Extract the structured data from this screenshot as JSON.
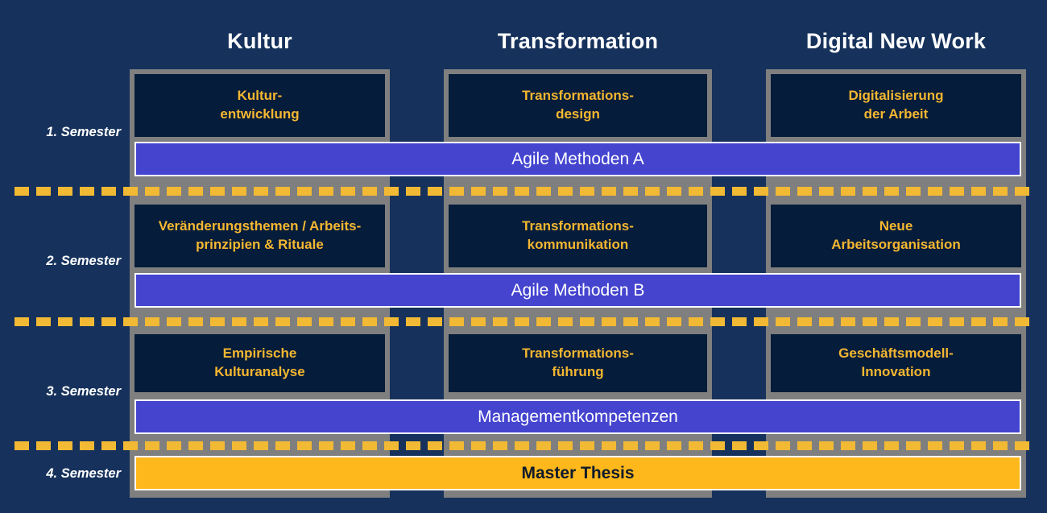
{
  "diagram": {
    "title_columns": [
      {
        "label": "Kultur"
      },
      {
        "label": "Transformation"
      },
      {
        "label": "Digital New Work"
      }
    ],
    "semesters": [
      {
        "label": "1. Semester"
      },
      {
        "label": "2. Semester"
      },
      {
        "label": "3. Semester"
      },
      {
        "label": "4. Semester"
      }
    ],
    "modules": {
      "s1": [
        {
          "text": "Kultur-\nentwicklung"
        },
        {
          "text": "Transformations-\ndesign"
        },
        {
          "text": "Digitalisierung\nder Arbeit"
        }
      ],
      "s2": [
        {
          "text": "Veränderungsthemen / Arbeits-\nprinzipien & Rituale"
        },
        {
          "text": "Transformations-\nkommunikation"
        },
        {
          "text": "Neue\nArbeitsorganisation"
        }
      ],
      "s3": [
        {
          "text": "Empirische\nKulturanalyse"
        },
        {
          "text": "Transformations-\nführung"
        },
        {
          "text": "Geschäftsmodell-\nInnovation"
        }
      ]
    },
    "bands": [
      {
        "label": "Agile Methoden A",
        "style": "blue"
      },
      {
        "label": "Agile Methoden B",
        "style": "blue"
      },
      {
        "label": "Managementkompetenzen",
        "style": "blue"
      },
      {
        "label": "Master Thesis",
        "style": "amber"
      }
    ],
    "colors": {
      "background": "#16325c",
      "column": "#7f7f7f",
      "module_box": "#051c3a",
      "module_text": "#f5b731",
      "band_blue": "#4444cf",
      "band_amber": "#ffb81c",
      "dash": "#f2b934",
      "header_text": "#ffffff"
    }
  }
}
